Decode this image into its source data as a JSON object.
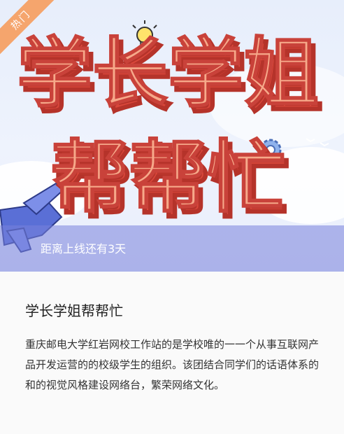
{
  "badge": {
    "label": "热门"
  },
  "banner": {
    "headline_line1": "学长学姐",
    "headline_line2": "帮帮忙",
    "countdown": "距离上线还有3天"
  },
  "card": {
    "title": "学长学姐帮帮忙",
    "description": "重庆邮电大学红岩网校工作站的是学校唯的一一个从事互联网产品开发运营的的校级学生的组织。该团结合同学们的话语体系的和的视觉风格建设网络台，繁荣网络文化。"
  },
  "colors": {
    "ribbon": "#f5a56d",
    "headline_fill": "#f6a98a",
    "headline_shadow": "#d9473b",
    "strip": "#7882dc"
  },
  "icons": [
    "lightbulb-icon",
    "gear-icon",
    "airplane-icon",
    "bird-icon"
  ]
}
